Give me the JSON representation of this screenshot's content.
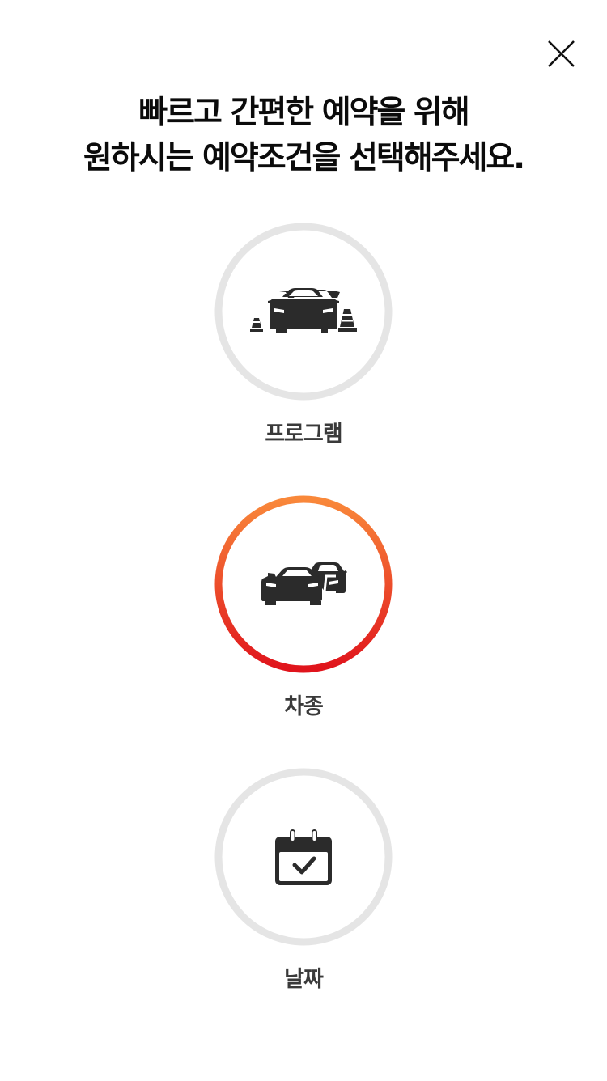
{
  "header": {
    "close_icon": "close-icon"
  },
  "title": {
    "line1": "빠르고 간편한 예약을 위해",
    "line2": "원하시는 예약조건을 선택해주세요."
  },
  "options": [
    {
      "label": "프로그램",
      "icon": "car-with-cones-icon",
      "selected": false
    },
    {
      "label": "차종",
      "icon": "two-cars-icon",
      "selected": true
    },
    {
      "label": "날짜",
      "icon": "calendar-check-icon",
      "selected": false
    }
  ],
  "colors": {
    "ring_default": "#e5e5e5",
    "ring_selected_start": "#f9883a",
    "ring_selected_end": "#e0141c",
    "icon": "#2b2b2b",
    "label": "#3a3a3a",
    "title": "#0b0b0b"
  }
}
